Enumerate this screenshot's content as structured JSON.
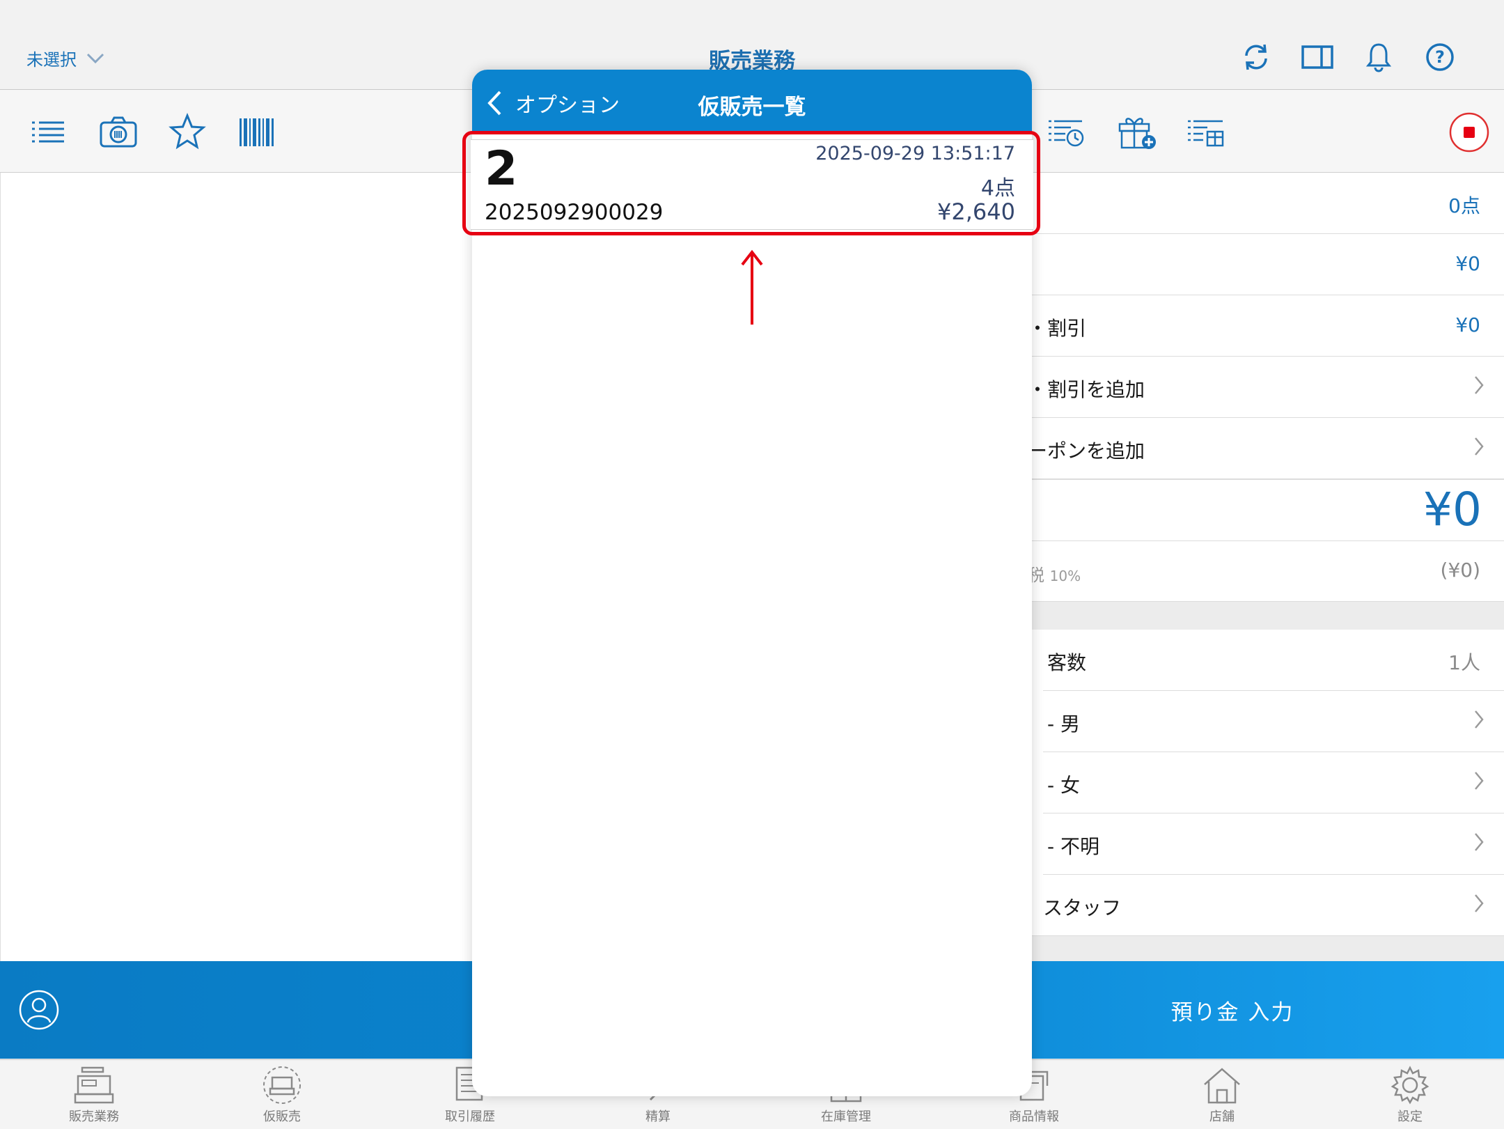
{
  "header": {
    "store_label": "未選択",
    "title": "販売業務",
    "icons": [
      "sync-icon",
      "split-view-icon",
      "bell-icon",
      "help-icon"
    ]
  },
  "toolbar": {
    "icons": [
      "list-icon",
      "camera-icon",
      "star-icon",
      "barcode-icon",
      "history-list-icon",
      "gift-add-icon",
      "bundle-list-icon",
      "stop-icon"
    ]
  },
  "summary": {
    "rows": [
      {
        "label": "",
        "value": "0点"
      },
      {
        "label": "",
        "value": "¥0"
      },
      {
        "label": "・割引",
        "value": "¥0"
      },
      {
        "label": "・割引を追加",
        "value": ""
      },
      {
        "label": "ーポンを追加",
        "value": ""
      }
    ],
    "total": "¥0",
    "tax_label": "税",
    "tax_rate": "10%",
    "tax_value": "(¥0)"
  },
  "customer": {
    "count_label": "客数",
    "count_value": "1人",
    "male": "- 男",
    "female": "- 女",
    "unknown": "- 不明",
    "staff": "スタッフ"
  },
  "action": {
    "deposit_label": "預り金 入力"
  },
  "modal": {
    "back_label": "オプション",
    "title": "仮販売一覧",
    "items": [
      {
        "number": "2",
        "datetime": "2025-09-29 13:51:17",
        "count": "4点",
        "id": "2025092900029",
        "amount": "¥2,640"
      }
    ]
  },
  "tabs": [
    {
      "label": "販売業務",
      "icon": "register-icon"
    },
    {
      "label": "仮販売",
      "icon": "temp-sale-icon"
    },
    {
      "label": "取引履歴",
      "icon": "ledger-icon"
    },
    {
      "label": "精算",
      "icon": "settlement-icon"
    },
    {
      "label": "在庫管理",
      "icon": "inventory-icon"
    },
    {
      "label": "商品情報",
      "icon": "product-icon"
    },
    {
      "label": "店舗",
      "icon": "store-icon"
    },
    {
      "label": "設定",
      "icon": "gear-icon"
    }
  ],
  "colors": {
    "accent": "#0b84cf",
    "highlight": "#e60012"
  }
}
